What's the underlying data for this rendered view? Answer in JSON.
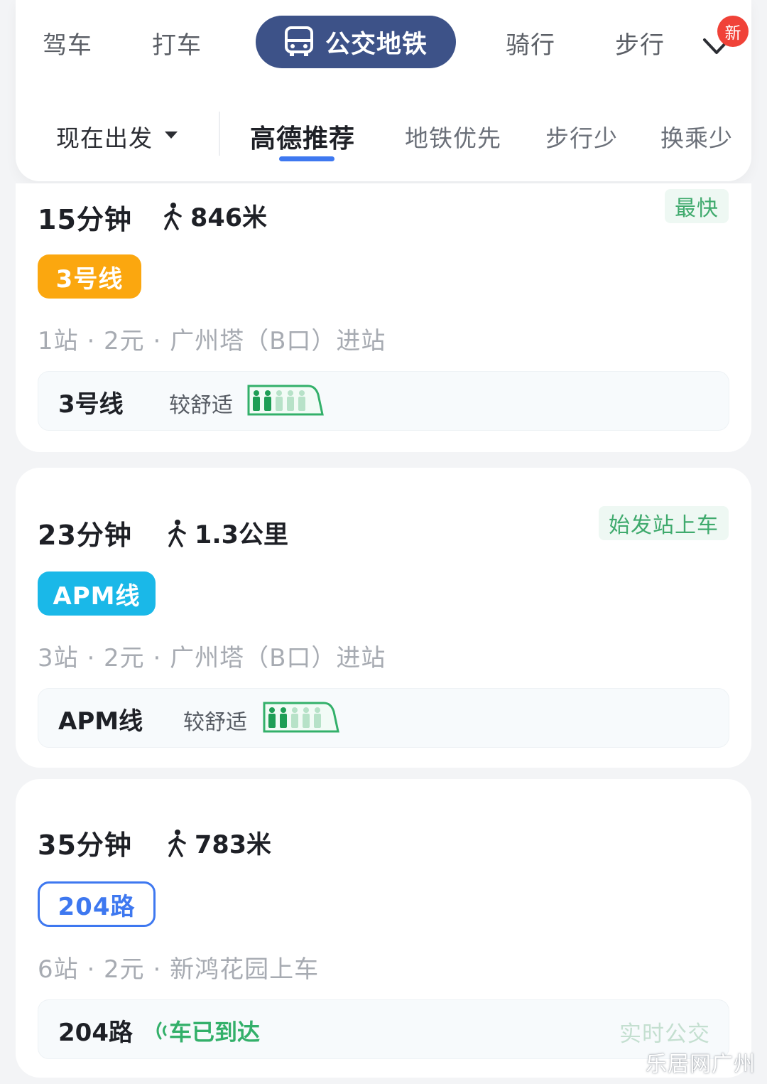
{
  "modes": {
    "drive": "驾车",
    "taxi": "打车",
    "transit": "公交地铁",
    "bike": "骑行",
    "walk": "步行",
    "new_badge": "新"
  },
  "filters": {
    "depart": "现在出发",
    "recommend": "高德推荐",
    "subway_first": "地铁优先",
    "less_walk": "步行少",
    "less_transfer": "换乘少"
  },
  "routes": [
    {
      "time": "15分钟",
      "walk": "846米",
      "tag": "最快",
      "badge": "3号线",
      "info": "1站 · 2元 · 广州塔（B口）进站",
      "sub_line": "3号线",
      "comfort": "较舒适",
      "crowd_level": 2
    },
    {
      "time": "23分钟",
      "walk": "1.3公里",
      "tag": "始发站上车",
      "badge": "APM线",
      "info": "3站 · 2元 · 广州塔（B口）进站",
      "sub_line": "APM线",
      "comfort": "较舒适",
      "crowd_level": 2
    },
    {
      "time": "35分钟",
      "walk": "783米",
      "badge": "204路",
      "info": "6站 · 2元 · 新鸿花园上车",
      "sub_line": "204路",
      "arrival": "车已到达",
      "realtime": "实时公交"
    }
  ],
  "colors": {
    "transit_active": "#3d5288",
    "line3": "#fba70f",
    "apm": "#1ab8e8",
    "bus": "#3e78f0",
    "green": "#33b06a"
  },
  "watermark": "乐居网广州"
}
